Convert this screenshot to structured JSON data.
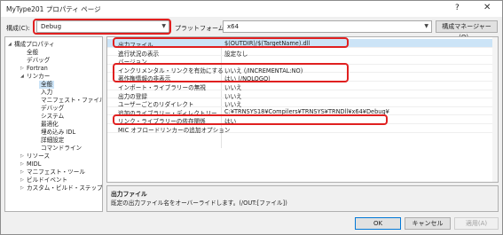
{
  "window": {
    "title": "MyType201 プロパティ ページ",
    "help": "?",
    "close": "✕"
  },
  "config": {
    "label": "構成(C):",
    "value": "Debug",
    "platform_label": "プラットフォーム(P):",
    "platform_value": "x64",
    "manager_button": "構成マネージャー(O)..."
  },
  "tree": [
    {
      "label": "構成プロパティ",
      "expanded": true
    },
    {
      "label": "全般"
    },
    {
      "label": "デバッグ"
    },
    {
      "label": "Fortran",
      "collapsed": true
    },
    {
      "label": "リンカー",
      "expanded": true
    },
    {
      "label": "全般",
      "selected": true
    },
    {
      "label": "入力"
    },
    {
      "label": "マニフェスト・ファイル"
    },
    {
      "label": "デバッグ"
    },
    {
      "label": "システム"
    },
    {
      "label": "最適化"
    },
    {
      "label": "埋め込み IDL"
    },
    {
      "label": "詳細設定"
    },
    {
      "label": "コマンドライン"
    },
    {
      "label": "リソース",
      "collapsed": true
    },
    {
      "label": "MIDL",
      "collapsed": true
    },
    {
      "label": "マニフェスト・ツール",
      "collapsed": true
    },
    {
      "label": "ビルドイベント",
      "collapsed": true
    },
    {
      "label": "カスタム・ビルド・ステップ",
      "collapsed": true
    }
  ],
  "properties": [
    {
      "name": "出力ファイル",
      "value": "$(OUTDIR)/$(TargetName).dll",
      "selected": true
    },
    {
      "name": "進行状況の表示",
      "value": "設定なし"
    },
    {
      "name": "バージョン",
      "value": ""
    },
    {
      "name": "インクリメンタル・リンクを有効にする",
      "value": "いいえ (/INCREMENTAL:NO)"
    },
    {
      "name": "著作権情報の非表示",
      "value": "はい (/NOLOGO)"
    },
    {
      "name": "インポート・ライブラリーの無視",
      "value": "いいえ"
    },
    {
      "name": "出力の登録",
      "value": "いいえ"
    },
    {
      "name": "ユーザーごとのリダイレクト",
      "value": "いいえ"
    },
    {
      "name": "追加のライブラリー・ディレクトリー",
      "value": "C:¥TRNSYS18¥Compilers¥TRNSYS¥TRNDll¥x64¥Debug¥"
    },
    {
      "name": "リンク・ライブラリーの依存関係",
      "value": "はい"
    },
    {
      "name": "MIC オフロードリンカーの追加オプション",
      "value": ""
    }
  ],
  "description": {
    "title": "出力ファイル",
    "text": "既定の出力ファイル名をオーバーライドします。(/OUT:[ファイル])"
  },
  "buttons": {
    "ok": "OK",
    "cancel": "キャンセル",
    "apply": "適用(A)"
  },
  "colors": {
    "highlight": "#e02020",
    "selection": "#cce4f7",
    "accent": "#0078d7"
  }
}
